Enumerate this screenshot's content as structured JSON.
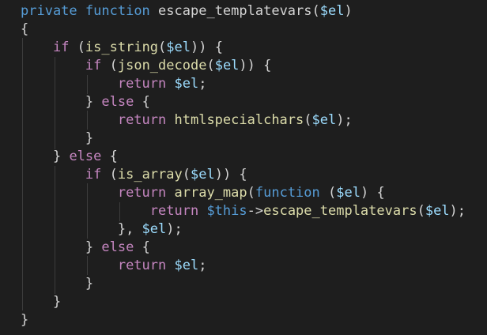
{
  "lines": [
    [
      {
        "t": "private",
        "c": "k"
      },
      {
        "t": " ",
        "c": "p"
      },
      {
        "t": "function",
        "c": "k"
      },
      {
        "t": " ",
        "c": "p"
      },
      {
        "t": "escape_templatevars",
        "c": "t"
      },
      {
        "t": "(",
        "c": "p"
      },
      {
        "t": "$el",
        "c": "v"
      },
      {
        "t": ")",
        "c": "p"
      }
    ],
    [
      {
        "t": "{",
        "c": "p"
      }
    ],
    [
      {
        "t": "    ",
        "c": "p"
      },
      {
        "t": "if",
        "c": "c"
      },
      {
        "t": " (",
        "c": "p"
      },
      {
        "t": "is_string",
        "c": "f"
      },
      {
        "t": "(",
        "c": "p"
      },
      {
        "t": "$el",
        "c": "v"
      },
      {
        "t": ")) {",
        "c": "p"
      }
    ],
    [
      {
        "t": "        ",
        "c": "p"
      },
      {
        "t": "if",
        "c": "c"
      },
      {
        "t": " (",
        "c": "p"
      },
      {
        "t": "json_decode",
        "c": "f"
      },
      {
        "t": "(",
        "c": "p"
      },
      {
        "t": "$el",
        "c": "v"
      },
      {
        "t": ")) {",
        "c": "p"
      }
    ],
    [
      {
        "t": "            ",
        "c": "p"
      },
      {
        "t": "return",
        "c": "c"
      },
      {
        "t": " ",
        "c": "p"
      },
      {
        "t": "$el",
        "c": "v"
      },
      {
        "t": ";",
        "c": "p"
      }
    ],
    [
      {
        "t": "        ",
        "c": "p"
      },
      {
        "t": "} ",
        "c": "p"
      },
      {
        "t": "else",
        "c": "c"
      },
      {
        "t": " {",
        "c": "p"
      }
    ],
    [
      {
        "t": "            ",
        "c": "p"
      },
      {
        "t": "return",
        "c": "c"
      },
      {
        "t": " ",
        "c": "p"
      },
      {
        "t": "htmlspecialchars",
        "c": "f"
      },
      {
        "t": "(",
        "c": "p"
      },
      {
        "t": "$el",
        "c": "v"
      },
      {
        "t": ");",
        "c": "p"
      }
    ],
    [
      {
        "t": "        ",
        "c": "p"
      },
      {
        "t": "}",
        "c": "p"
      }
    ],
    [
      {
        "t": "    ",
        "c": "p"
      },
      {
        "t": "} ",
        "c": "p"
      },
      {
        "t": "else",
        "c": "c"
      },
      {
        "t": " {",
        "c": "p"
      }
    ],
    [
      {
        "t": "        ",
        "c": "p"
      },
      {
        "t": "if",
        "c": "c"
      },
      {
        "t": " (",
        "c": "p"
      },
      {
        "t": "is_array",
        "c": "f"
      },
      {
        "t": "(",
        "c": "p"
      },
      {
        "t": "$el",
        "c": "v"
      },
      {
        "t": ")) {",
        "c": "p"
      }
    ],
    [
      {
        "t": "            ",
        "c": "p"
      },
      {
        "t": "return",
        "c": "c"
      },
      {
        "t": " ",
        "c": "p"
      },
      {
        "t": "array_map",
        "c": "f"
      },
      {
        "t": "(",
        "c": "p"
      },
      {
        "t": "function",
        "c": "k"
      },
      {
        "t": " (",
        "c": "p"
      },
      {
        "t": "$el",
        "c": "v"
      },
      {
        "t": ") {",
        "c": "p"
      }
    ],
    [
      {
        "t": "                ",
        "c": "p"
      },
      {
        "t": "return",
        "c": "c"
      },
      {
        "t": " ",
        "c": "p"
      },
      {
        "t": "$this",
        "c": "k"
      },
      {
        "t": "->",
        "c": "p"
      },
      {
        "t": "escape_templatevars",
        "c": "f"
      },
      {
        "t": "(",
        "c": "p"
      },
      {
        "t": "$el",
        "c": "v"
      },
      {
        "t": ");",
        "c": "p"
      }
    ],
    [
      {
        "t": "            ",
        "c": "p"
      },
      {
        "t": "}, ",
        "c": "p"
      },
      {
        "t": "$el",
        "c": "v"
      },
      {
        "t": ");",
        "c": "p"
      }
    ],
    [
      {
        "t": "        ",
        "c": "p"
      },
      {
        "t": "} ",
        "c": "p"
      },
      {
        "t": "else",
        "c": "c"
      },
      {
        "t": " {",
        "c": "p"
      }
    ],
    [
      {
        "t": "            ",
        "c": "p"
      },
      {
        "t": "return",
        "c": "c"
      },
      {
        "t": " ",
        "c": "p"
      },
      {
        "t": "$el",
        "c": "v"
      },
      {
        "t": ";",
        "c": "p"
      }
    ],
    [
      {
        "t": "        ",
        "c": "p"
      },
      {
        "t": "}",
        "c": "p"
      }
    ],
    [
      {
        "t": "    ",
        "c": "p"
      },
      {
        "t": "}",
        "c": "p"
      }
    ],
    [
      {
        "t": "}",
        "c": "p"
      }
    ]
  ]
}
